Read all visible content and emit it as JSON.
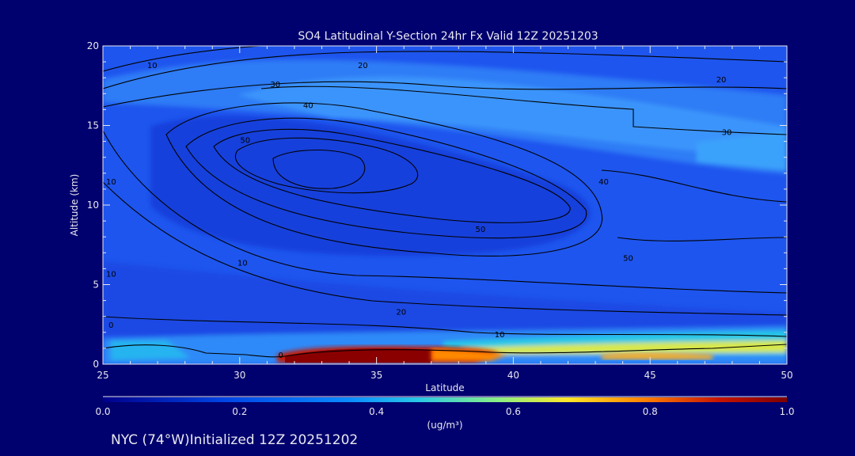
{
  "chart_data": {
    "type": "heatmap",
    "title": "SO4 Latitudinal Y-Section 24hr  Fx Valid 12Z 20251203",
    "xlabel": "Latitude",
    "ylabel": "Altitude (km)",
    "xlim": [
      25,
      50
    ],
    "ylim": [
      0,
      20
    ],
    "x_ticks": [
      25,
      30,
      35,
      40,
      45,
      50
    ],
    "y_ticks": [
      0,
      5,
      10,
      15,
      20
    ],
    "colorbar": {
      "ticks": [
        "0.0",
        "0.2",
        "0.4",
        "0.6",
        "0.8",
        "1.0"
      ],
      "range": [
        0,
        1
      ],
      "unit_label": "(ug/m³)",
      "colors": [
        "#00008c",
        "#0046e6",
        "#0a8cff",
        "#28c8e6",
        "#8cf082",
        "#ffe628",
        "#ff8200",
        "#c81400",
        "#7d0000"
      ]
    },
    "grid": false,
    "field_description_values": {
      "upper_band_altitude_km": [
        13,
        17
      ],
      "upper_band_value": 0.2,
      "surface_plume_latitude": [
        31.5,
        38
      ],
      "surface_plume_peak_value": 1.0
    },
    "contour_labels": [
      {
        "text": "10",
        "lat": 26.8,
        "alt": 18.8
      },
      {
        "text": "20",
        "lat": 34.5,
        "alt": 18.8
      },
      {
        "text": "30",
        "lat": 31.3,
        "alt": 17.6
      },
      {
        "text": "40",
        "lat": 32.5,
        "alt": 16.3
      },
      {
        "text": "50",
        "lat": 30.2,
        "alt": 14.1
      },
      {
        "text": "20",
        "lat": 47.6,
        "alt": 17.9
      },
      {
        "text": "30",
        "lat": 47.8,
        "alt": 14.6
      },
      {
        "text": "40",
        "lat": 43.3,
        "alt": 11.5
      },
      {
        "text": "50",
        "lat": 38.8,
        "alt": 8.5
      },
      {
        "text": "50",
        "lat": 44.2,
        "alt": 6.7
      },
      {
        "text": "10",
        "lat": 25.3,
        "alt": 11.5
      },
      {
        "text": "10",
        "lat": 30.1,
        "alt": 6.4
      },
      {
        "text": "10",
        "lat": 25.3,
        "alt": 5.7
      },
      {
        "text": "20",
        "lat": 35.9,
        "alt": 3.3
      },
      {
        "text": "10",
        "lat": 39.5,
        "alt": 1.9
      },
      {
        "text": "0",
        "lat": 25.3,
        "alt": 2.5
      },
      {
        "text": "0",
        "lat": 31.5,
        "alt": 0.6
      }
    ]
  },
  "footer": {
    "location": "NYC (74°W)Initialized 12Z 20251202"
  }
}
